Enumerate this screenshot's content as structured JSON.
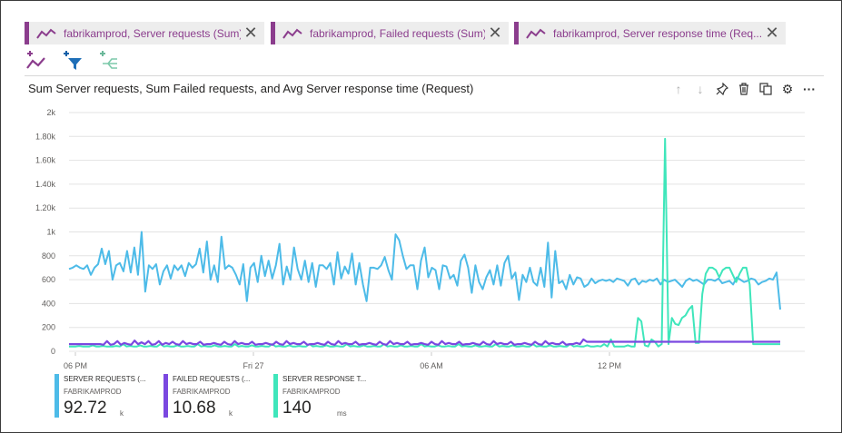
{
  "pills": [
    {
      "label": "fabrikamprod, Server requests (Sum)",
      "icon": "metric-line-icon"
    },
    {
      "label": "fabrikamprod, Failed requests (Sum)",
      "icon": "metric-line-icon"
    },
    {
      "label": "fabrikamprod, Server response time (Req...",
      "icon": "metric-line-icon"
    }
  ],
  "toolbar": {
    "add_metric_icon": "add-metric-icon",
    "add_filter_icon": "add-filter-icon",
    "apply_splitting_icon": "apply-splitting-icon"
  },
  "chart_header": {
    "title": "Sum Server requests, Sum Failed requests, and Avg Server response time (Request)",
    "actions": [
      "move-up-icon",
      "move-down-icon",
      "pin-icon",
      "delete-icon",
      "clone-icon",
      "settings-icon",
      "more-icon"
    ]
  },
  "colors": {
    "pill_accent": "#8b3d8d",
    "server_requests": "#4dbbe8",
    "failed_requests": "#7b48e0",
    "response_time": "#3fe6bb"
  },
  "chart_data": {
    "type": "line",
    "y_tick_labels": [
      "0",
      "200",
      "400",
      "600",
      "800",
      "1k",
      "1.20k",
      "1.40k",
      "1.60k",
      "1.80k",
      "2k"
    ],
    "ylim": [
      0,
      2000
    ],
    "x_tick_labels": [
      "06 PM",
      "Fri 27",
      "06 AM",
      "12 PM"
    ],
    "grid": true,
    "series": [
      {
        "name": "SERVER REQUESTS (...",
        "values": [
          690,
          700,
          720,
          700,
          690,
          720,
          640,
          700,
          730,
          860,
          730,
          840,
          600,
          720,
          740,
          670,
          840,
          660,
          870,
          640,
          1000,
          500,
          720,
          690,
          730,
          560,
          670,
          720,
          610,
          720,
          680,
          720,
          630,
          740,
          700,
          730,
          860,
          660,
          920,
          600,
          720,
          580,
          960,
          690,
          720,
          700,
          640,
          560,
          730,
          420,
          700,
          740,
          580,
          800,
          630,
          760,
          610,
          720,
          900,
          560,
          710,
          600,
          870,
          690,
          600,
          760,
          580,
          740,
          540,
          720,
          720,
          690,
          740,
          560,
          830,
          610,
          710,
          650,
          820,
          560,
          740,
          560,
          420,
          700,
          700,
          690,
          720,
          790,
          680,
          600,
          980,
          930,
          800,
          690,
          720,
          720,
          520,
          760,
          870,
          620,
          700,
          680,
          520,
          720,
          710,
          610,
          640,
          550,
          760,
          810,
          700,
          490,
          720,
          580,
          520,
          620,
          680,
          560,
          720,
          550,
          740,
          800,
          610,
          660,
          430,
          640,
          580,
          700,
          580,
          550,
          700,
          540,
          910,
          450,
          840,
          570,
          590,
          520,
          640,
          560,
          620,
          610,
          540,
          560,
          610,
          570,
          590,
          600,
          590,
          600,
          580,
          610,
          600,
          590,
          550,
          600,
          610,
          560,
          590,
          580,
          600,
          590,
          610,
          560,
          600,
          580,
          590,
          600,
          570,
          540,
          590,
          610,
          590,
          600,
          580,
          560,
          600,
          600,
          590,
          610,
          570,
          580,
          590,
          560,
          620,
          600,
          580,
          590,
          610,
          600,
          560,
          580,
          590,
          610,
          600,
          660,
          350
        ]
      },
      {
        "name": "FAILED REQUESTS (...",
        "values": [
          60,
          60,
          60,
          60,
          60,
          60,
          60,
          60,
          60,
          60,
          55,
          85,
          55,
          60,
          85,
          55,
          70,
          60,
          55,
          90,
          60,
          75,
          60,
          85,
          55,
          60,
          85,
          55,
          70,
          60,
          80,
          60,
          55,
          85,
          60,
          70,
          60,
          60,
          80,
          55,
          60,
          60,
          70,
          60,
          55,
          80,
          60,
          55,
          85,
          60,
          70,
          60,
          60,
          80,
          55,
          60,
          60,
          70,
          60,
          55,
          80,
          60,
          55,
          85,
          60,
          70,
          60,
          60,
          80,
          55,
          60,
          60,
          70,
          60,
          55,
          80,
          60,
          55,
          85,
          60,
          70,
          60,
          60,
          80,
          55,
          60,
          60,
          70,
          60,
          55,
          80,
          60,
          55,
          85,
          60,
          70,
          60,
          60,
          80,
          55,
          60,
          60,
          70,
          60,
          55,
          80,
          60,
          55,
          85,
          60,
          70,
          60,
          60,
          80,
          55,
          60,
          60,
          70,
          60,
          55,
          80,
          60,
          55,
          85,
          60,
          70,
          60,
          60,
          80,
          55,
          60,
          60,
          70,
          60,
          55,
          80,
          60,
          55,
          85,
          60,
          70,
          60,
          60,
          80,
          55,
          60,
          60,
          70,
          60,
          100,
          80,
          80,
          80,
          80,
          80,
          80,
          80,
          80,
          80,
          80,
          80,
          80,
          80,
          80,
          80,
          80,
          80,
          80,
          80,
          80,
          80,
          80,
          80,
          80,
          80,
          80,
          80,
          80,
          80,
          80,
          80,
          80,
          80,
          80,
          80,
          80,
          80,
          80,
          80,
          80,
          80,
          80,
          80,
          80,
          80,
          80,
          80,
          80,
          80,
          80,
          80,
          80,
          80,
          80,
          80,
          80,
          80
        ]
      },
      {
        "name": "SERVER RESPONSE T...",
        "values": [
          40,
          40,
          40,
          45,
          40,
          40,
          40,
          50,
          40,
          40,
          45,
          40,
          40,
          40,
          45,
          40,
          60,
          40,
          45,
          40,
          40,
          50,
          40,
          40,
          45,
          40,
          40,
          60,
          40,
          45,
          40,
          40,
          50,
          40,
          40,
          45,
          40,
          40,
          60,
          40,
          45,
          40,
          40,
          50,
          40,
          40,
          45,
          40,
          40,
          60,
          40,
          45,
          40,
          40,
          50,
          40,
          40,
          45,
          40,
          40,
          60,
          40,
          45,
          40,
          40,
          50,
          40,
          40,
          45,
          40,
          40,
          60,
          40,
          45,
          40,
          40,
          50,
          40,
          40,
          45,
          40,
          40,
          60,
          40,
          45,
          40,
          40,
          50,
          40,
          40,
          45,
          40,
          40,
          60,
          40,
          45,
          40,
          40,
          50,
          40,
          40,
          45,
          40,
          40,
          60,
          40,
          45,
          40,
          40,
          50,
          40,
          40,
          45,
          40,
          40,
          60,
          40,
          45,
          40,
          40,
          50,
          40,
          40,
          45,
          40,
          40,
          60,
          40,
          45,
          40,
          40,
          50,
          40,
          40,
          45,
          40,
          40,
          60,
          40,
          45,
          40,
          40,
          50,
          40,
          40,
          45,
          40,
          40,
          60,
          40,
          45,
          40,
          40,
          50,
          40,
          40,
          45,
          40,
          60,
          40,
          100,
          40,
          40,
          40,
          40,
          50,
          40,
          40,
          280,
          250,
          50,
          40,
          100,
          80,
          40,
          60,
          1780,
          60,
          280,
          230,
          220,
          280,
          300,
          350,
          380,
          70,
          70,
          480,
          650,
          700,
          700,
          680,
          620,
          680,
          700,
          700,
          640,
          580,
          650,
          700,
          700,
          560,
          60,
          60,
          60,
          60,
          60,
          60,
          60,
          60,
          60
        ]
      }
    ]
  },
  "legend": [
    {
      "name": "SERVER REQUESTS (...",
      "sub": "FABRIKAMPROD",
      "value": "92.72",
      "unit": "k"
    },
    {
      "name": "FAILED REQUESTS (...",
      "sub": "FABRIKAMPROD",
      "value": "10.68",
      "unit": "k"
    },
    {
      "name": "SERVER RESPONSE T...",
      "sub": "FABRIKAMPROD",
      "value": "140",
      "unit": "ms"
    }
  ]
}
